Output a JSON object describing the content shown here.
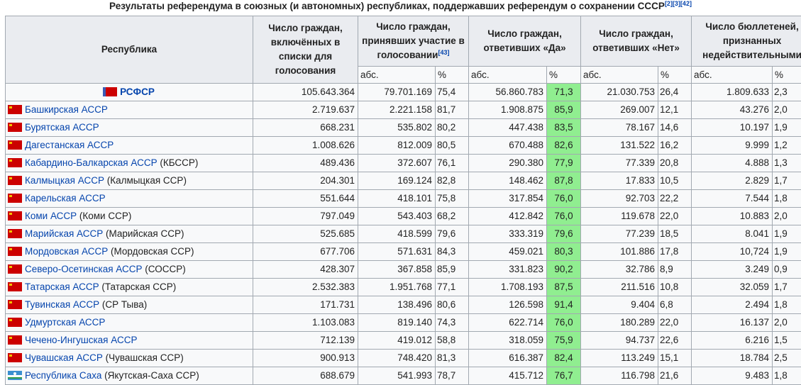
{
  "caption": {
    "text": "Результаты референдума в союзных (и автономных) республиках, поддержавших референдум о сохранении СССР",
    "refs": [
      "[2]",
      "[3]",
      "[42]"
    ]
  },
  "headers": {
    "republic": "Республика",
    "registered": "Число граждан, включённых в списки для голосования",
    "participated": "Число граждан, принявших участие в голосовании",
    "participated_ref": "[43]",
    "yes": "Число граждан, ответивших «Да»",
    "no": "Число граждан, ответивших «Нет»",
    "invalid": "Число бюллетеней, признанных недействительными",
    "abs": "абс.",
    "pct": "%"
  },
  "rows": [
    {
      "name": "РСФСР",
      "extra": "",
      "flag": "rsfsr",
      "bold": true,
      "registered": "105.643.364",
      "part_abs": "79.701.169",
      "part_pct": "75,4",
      "yes_abs": "56.860.783",
      "yes_pct": "71,3",
      "no_abs": "21.030.753",
      "no_pct": "26,4",
      "inv_abs": "1.809.633",
      "inv_pct": "2,3"
    },
    {
      "name": "Башкирская АССР",
      "extra": "",
      "flag": "asr",
      "bold": false,
      "registered": "2.719.637",
      "part_abs": "2.221.158",
      "part_pct": "81,7",
      "yes_abs": "1.908.875",
      "yes_pct": "85,9",
      "no_abs": "269.007",
      "no_pct": "12,1",
      "inv_abs": "43.276",
      "inv_pct": "2,0"
    },
    {
      "name": "Бурятская АССР",
      "extra": "",
      "flag": "asr",
      "bold": false,
      "registered": "668.231",
      "part_abs": "535.802",
      "part_pct": "80,2",
      "yes_abs": "447.438",
      "yes_pct": "83,5",
      "no_abs": "78.167",
      "no_pct": "14,6",
      "inv_abs": "10.197",
      "inv_pct": "1,9"
    },
    {
      "name": "Дагестанская АССР",
      "extra": "",
      "flag": "asr",
      "bold": false,
      "registered": "1.008.626",
      "part_abs": "812.009",
      "part_pct": "80,5",
      "yes_abs": "670.488",
      "yes_pct": "82,6",
      "no_abs": "131.522",
      "no_pct": "16,2",
      "inv_abs": "9.999",
      "inv_pct": "1,2"
    },
    {
      "name": "Кабардино-Балкарская АССР",
      "extra": " (КБССР)",
      "flag": "asr",
      "bold": false,
      "registered": "489.436",
      "part_abs": "372.607",
      "part_pct": "76,1",
      "yes_abs": "290.380",
      "yes_pct": "77,9",
      "no_abs": "77.339",
      "no_pct": "20,8",
      "inv_abs": "4.888",
      "inv_pct": "1,3"
    },
    {
      "name": "Калмыцкая АССР",
      "extra": " (Калмыцкая ССР)",
      "flag": "asr",
      "bold": false,
      "registered": "204.301",
      "part_abs": "169.124",
      "part_pct": "82,8",
      "yes_abs": "148.462",
      "yes_pct": "87,8",
      "no_abs": "17.833",
      "no_pct": "10,5",
      "inv_abs": "2.829",
      "inv_pct": "1,7"
    },
    {
      "name": "Карельская АССР",
      "extra": "",
      "flag": "asr",
      "bold": false,
      "registered": "551.644",
      "part_abs": "418.101",
      "part_pct": "75,8",
      "yes_abs": "317.854",
      "yes_pct": "76,0",
      "no_abs": "92.703",
      "no_pct": "22,2",
      "inv_abs": "7.544",
      "inv_pct": "1,8"
    },
    {
      "name": "Коми АССР",
      "extra": " (Коми ССР)",
      "flag": "asr",
      "bold": false,
      "registered": "797.049",
      "part_abs": "543.403",
      "part_pct": "68,2",
      "yes_abs": "412.842",
      "yes_pct": "76,0",
      "no_abs": "119.678",
      "no_pct": "22,0",
      "inv_abs": "10.883",
      "inv_pct": "2,0"
    },
    {
      "name": "Марийская АССР",
      "extra": " (Марийская ССР)",
      "flag": "asr",
      "bold": false,
      "registered": "525.685",
      "part_abs": "418.599",
      "part_pct": "79,6",
      "yes_abs": "333.319",
      "yes_pct": "79,6",
      "no_abs": "77.239",
      "no_pct": "18,5",
      "inv_abs": "8.041",
      "inv_pct": "1,9"
    },
    {
      "name": "Мордовская АССР",
      "extra": " (Мордовская ССР)",
      "flag": "asr",
      "bold": false,
      "registered": "677.706",
      "part_abs": "571.631",
      "part_pct": "84,3",
      "yes_abs": "459.021",
      "yes_pct": "80,3",
      "no_abs": "101.886",
      "no_pct": "17,8",
      "inv_abs": "10,724",
      "inv_pct": "1,9"
    },
    {
      "name": "Северо-Осетинская АССР",
      "extra": " (СОССР)",
      "flag": "asr",
      "bold": false,
      "registered": "428.307",
      "part_abs": "367.858",
      "part_pct": "85,9",
      "yes_abs": "331.823",
      "yes_pct": "90,2",
      "no_abs": "32.786",
      "no_pct": "8,9",
      "inv_abs": "3.249",
      "inv_pct": "0,9"
    },
    {
      "name": "Татарская АССР",
      "extra": " (Татарская ССР)",
      "flag": "asr",
      "bold": false,
      "registered": "2.532.383",
      "part_abs": "1.951.768",
      "part_pct": "77,1",
      "yes_abs": "1.708.193",
      "yes_pct": "87,5",
      "no_abs": "211.516",
      "no_pct": "10,8",
      "inv_abs": "32.059",
      "inv_pct": "1,7"
    },
    {
      "name": "Тувинская АССР",
      "extra": " (СР Тыва)",
      "flag": "asr",
      "bold": false,
      "registered": "171.731",
      "part_abs": "138.496",
      "part_pct": "80,6",
      "yes_abs": "126.598",
      "yes_pct": "91,4",
      "no_abs": "9.404",
      "no_pct": "6,8",
      "inv_abs": "2.494",
      "inv_pct": "1,8"
    },
    {
      "name": "Удмуртская АССР",
      "extra": "",
      "flag": "asr",
      "bold": false,
      "registered": "1.103.083",
      "part_abs": "819.140",
      "part_pct": "74,3",
      "yes_abs": "622.714",
      "yes_pct": "76,0",
      "no_abs": "180.289",
      "no_pct": "22,0",
      "inv_abs": "16.137",
      "inv_pct": "2,0"
    },
    {
      "name": "Чечено-Ингушская АССР",
      "extra": "",
      "flag": "asr",
      "bold": false,
      "registered": "712.139",
      "part_abs": "419.012",
      "part_pct": "58,8",
      "yes_abs": "318.059",
      "yes_pct": "75,9",
      "no_abs": "94.737",
      "no_pct": "22,6",
      "inv_abs": "6.216",
      "inv_pct": "1,5"
    },
    {
      "name": "Чувашская АССР",
      "extra": " (Чувашская ССР)",
      "flag": "asr",
      "bold": false,
      "registered": "900.913",
      "part_abs": "748.420",
      "part_pct": "81,3",
      "yes_abs": "616.387",
      "yes_pct": "82,4",
      "no_abs": "113.249",
      "no_pct": "15,1",
      "inv_abs": "18.784",
      "inv_pct": "2,5"
    },
    {
      "name": "Республика Саха",
      "extra": " (Якутская-Саха ССР)",
      "flag": "saha",
      "bold": false,
      "registered": "688.679",
      "part_abs": "541.993",
      "part_pct": "78,7",
      "yes_abs": "415.712",
      "yes_pct": "76,7",
      "no_abs": "116.798",
      "no_pct": "21,6",
      "inv_abs": "9.483",
      "inv_pct": "1,8"
    }
  ]
}
